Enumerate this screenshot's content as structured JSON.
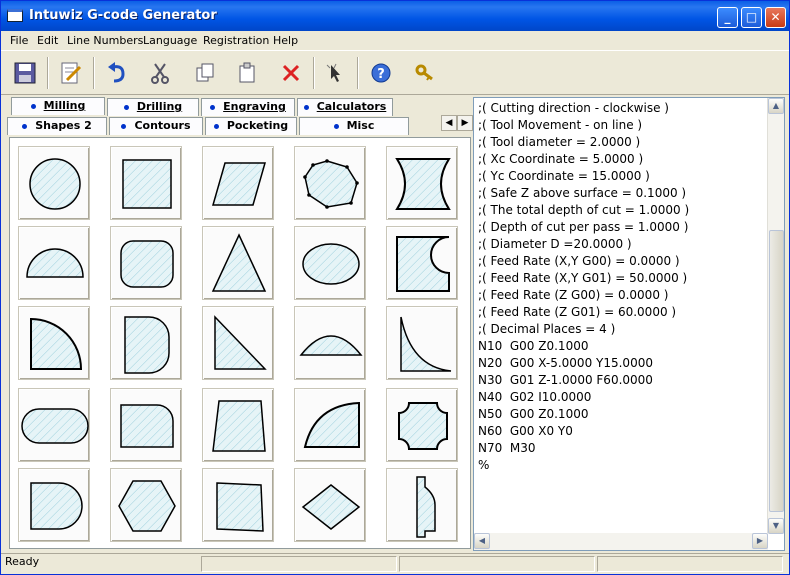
{
  "window": {
    "title": "Intuwiz G-code Generator"
  },
  "menu": [
    "File",
    "Edit",
    "Line Numbers",
    "Language",
    "Registration",
    "Help"
  ],
  "toolbar": {
    "buttons": [
      "save-icon",
      "edit-icon",
      "undo-icon",
      "cut-icon",
      "copy-icon",
      "paste-icon",
      "delete-icon",
      "pointer-icon",
      "help-icon",
      "key-icon"
    ]
  },
  "tabs": {
    "row1": [
      "Milling",
      "Drilling",
      "Engraving",
      "Calculators"
    ],
    "row2": [
      "Shapes 2",
      "Contours",
      "Pocketing",
      "Misc"
    ]
  },
  "code": {
    "lines": [
      ";( Cutting direction - clockwise )",
      ";( Tool Movement - on line )",
      ";( Tool diameter = 2.0000 )",
      ";( Xc Coordinate = 5.0000 )",
      ";( Yc Coordinate = 15.0000 )",
      ";( Safe Z above surface = 0.1000 )",
      ";( The total depth of cut = 1.0000 )",
      ";( Depth of cut per pass = 1.0000 )",
      ";( Diameter D =20.0000 )",
      ";( Feed Rate (X,Y G00) = 0.0000 )",
      ";( Feed Rate (X,Y G01) = 50.0000 )",
      ";( Feed Rate (Z G00) = 0.0000 )",
      ";( Feed Rate (Z G01) = 60.0000 )",
      ";( Decimal Places = 4 )",
      "N10  G00 Z0.1000",
      "N20  G00 X-5.0000 Y15.0000",
      "N30  G01 Z-1.0000 F60.0000",
      "N40  G02 I10.0000",
      "N50  G00 Z0.1000",
      "N60  G00 X0 Y0",
      "N70  M30",
      "%"
    ]
  },
  "status": {
    "text": "Ready"
  },
  "colors": {
    "titlebar": "#0055e5",
    "shape_fill": "#dff0f4",
    "hatch": "#9ccfdc",
    "tab_dot": "#0033cc"
  }
}
